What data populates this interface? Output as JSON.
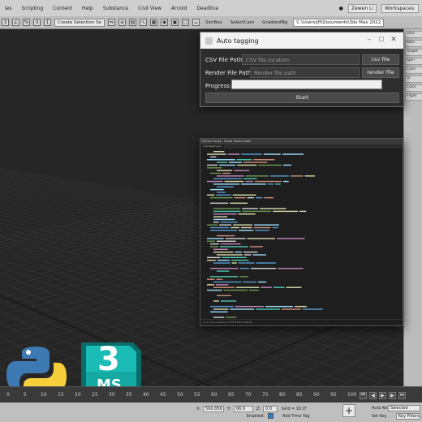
{
  "menubar": {
    "items": [
      "les",
      "Scripting",
      "Content",
      "Help",
      "Substance",
      "Civil View",
      "Arnold",
      "Deadline"
    ],
    "user": "Zewen Li",
    "workspaces": "Workspaces:"
  },
  "toolbar": {
    "selection_set": "Create Selection Se",
    "buttons": [
      "SimBox",
      "SelectCam",
      "GradientBg"
    ],
    "path": "C:\\Users\\jff\\Documents\\3ds Max 2022"
  },
  "dialog": {
    "title": "Auto tagging",
    "csv_label": "CSV File Path:",
    "csv_placeholder": "CSV file location",
    "csv_button": "csv file",
    "render_label": "Render File Path:",
    "render_placeholder": "Render file path",
    "render_button": "render file",
    "progress_label": "Progress:",
    "progress_value": 0,
    "start_button": "Start"
  },
  "right_panel": {
    "tabs": [
      "Stan",
      "Stan",
      "Target",
      "Spin",
      "Cylin",
      "Tc",
      "Color",
      "Flight"
    ]
  },
  "editor": {
    "title": "Python Script - Visual Studio Code",
    "tab": "AutoTagging.py",
    "status": "Ln 1, Col 1   Spaces: 4   UTF-8   CRLF   Python"
  },
  "timeline": {
    "ticks": [
      "0",
      "5",
      "10",
      "15",
      "20",
      "25",
      "30",
      "35",
      "40",
      "45",
      "50",
      "55",
      "60",
      "65",
      "70",
      "75",
      "80",
      "85",
      "90",
      "95",
      "100"
    ]
  },
  "statusbar": {
    "x_label": "X:",
    "x_value": "590.858",
    "y_label": "Y:",
    "y_value": "66.6",
    "z_label": "Z:",
    "z_value": "0.0",
    "grid": "Grid = 10.0\"",
    "enabled": "Enabled:",
    "add_time_tag": "Add Time Tag",
    "auto_key": "Auto Key",
    "set_key": "Set Key",
    "selected": "Selected",
    "key_filters": "Key Filters..."
  },
  "logos": {
    "ms_text": "MS",
    "ms_number": "3"
  }
}
